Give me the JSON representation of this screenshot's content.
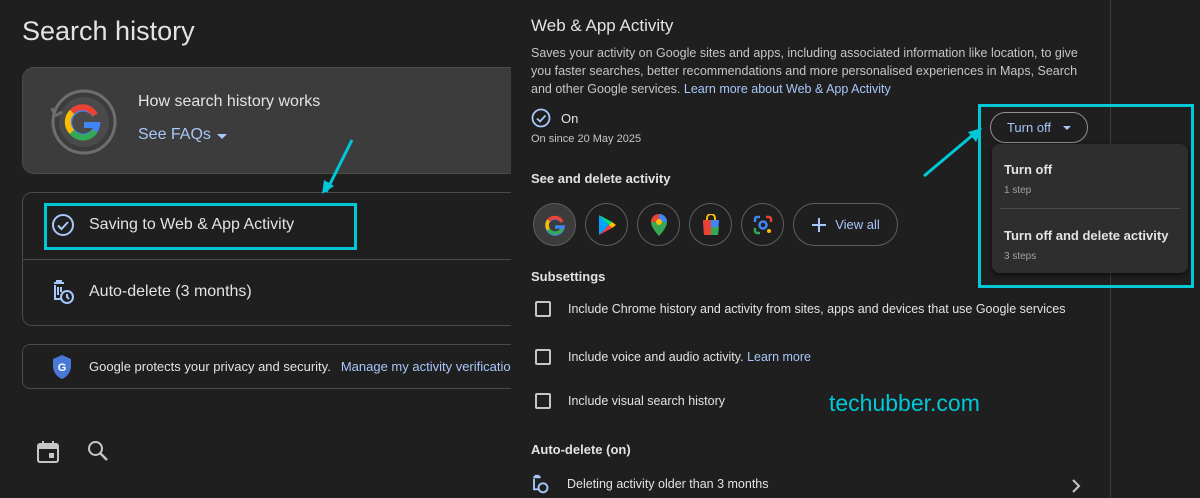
{
  "left": {
    "title": "Search history",
    "faq_card": {
      "title": "How search history works",
      "link": "See FAQs"
    },
    "settings": {
      "saving_label": "Saving to Web & App Activity",
      "auto_delete_label": "Auto-delete (3 months)"
    },
    "privacy": {
      "text": "Google protects your privacy and security.",
      "link": "Manage my activity verification"
    },
    "bottom_icons": [
      "calendar-icon",
      "search-icon"
    ]
  },
  "right": {
    "title": "Web & App Activity",
    "description": "Saves your activity on Google sites and apps, including associated information like location, to give you faster searches, better recommendations and more personalised experiences in Maps, Search and other Google services.",
    "learn_more_link": "Learn more about Web & App Activity",
    "status_label": "On",
    "since_label": "On since 20 May 2025",
    "see_delete_heading": "See and delete activity",
    "apps": [
      "google-search-icon",
      "google-play-icon",
      "google-maps-icon",
      "google-shopping-icon",
      "google-lens-icon"
    ],
    "view_all_label": "View all",
    "subsettings_heading": "Subsettings",
    "subsettings": [
      {
        "label": "Include Chrome history and activity from sites, apps and devices that use Google services",
        "link": ""
      },
      {
        "label": "Include voice and audio activity.",
        "link": "Learn more"
      },
      {
        "label": "Include visual search history",
        "link": ""
      }
    ],
    "auto_delete_heading": "Auto-delete (on)",
    "auto_delete_row": "Deleting activity older than 3 months",
    "watermark": "techubber.com"
  },
  "turn_off": {
    "button_label": "Turn off",
    "menu": [
      {
        "title": "Turn off",
        "subtitle": "1 step"
      },
      {
        "title": "Turn off and delete activity",
        "subtitle": "3 steps"
      }
    ]
  },
  "colors": {
    "accent": "#00c8d7",
    "link": "#a8c7fa",
    "background": "#1f1f1f"
  }
}
